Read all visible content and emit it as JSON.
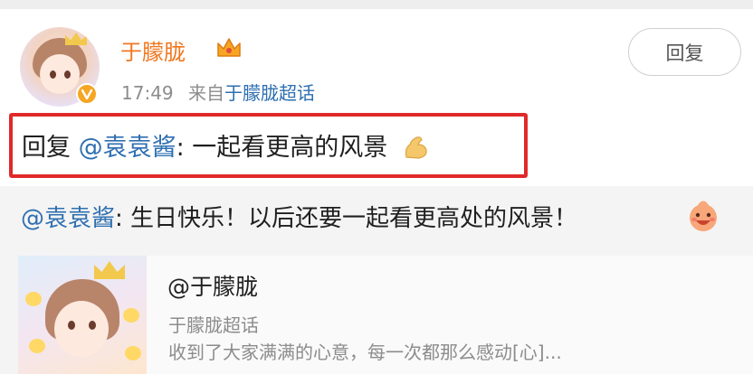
{
  "post": {
    "username": "于朦胧",
    "time": "17:49",
    "source_prefix": "来自",
    "source": "于朦胧超话",
    "reply_button": "回复",
    "reply_prefix": "回复",
    "reply_mention": "@袁袁酱",
    "reply_body": ": 一起看更高的风景"
  },
  "quoted": {
    "mention": "@袁袁酱",
    "body": ": 生日快乐！以后还要一起看更高处的风景！"
  },
  "card": {
    "title": "@于朦胧",
    "subtitle": "于朦胧超话",
    "description": "收到了大家满满的心意，每一次都那么感动[心]..."
  },
  "icons": {
    "crown": "crown-icon",
    "verified": "verified-badge-icon",
    "flexed_arm": "flexed-arm-emoji-icon",
    "smile": "smile-emoji-icon"
  },
  "colors": {
    "username": "#f0771f",
    "link": "#2e6fb1",
    "highlight": "#e0292a",
    "muted": "#8c8c8c"
  }
}
